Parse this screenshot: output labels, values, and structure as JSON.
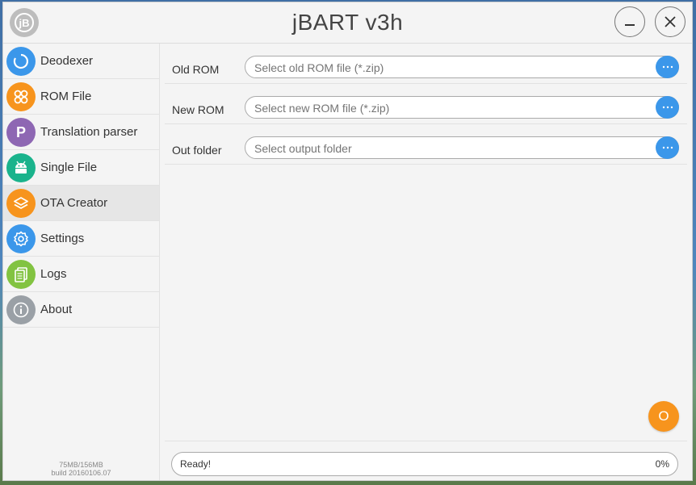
{
  "window": {
    "title": "jBART v3h",
    "logo_glyph": "jB"
  },
  "sidebar": {
    "items": [
      {
        "label": "Deodexer",
        "icon": "refresh-ring-icon",
        "color": "#3b97ea"
      },
      {
        "label": "ROM File",
        "icon": "grid-circles-icon",
        "color": "#f7941d"
      },
      {
        "label": "Translation parser",
        "icon": "p-letter-icon",
        "color": "#8e67b3"
      },
      {
        "label": "Single File",
        "icon": "android-icon",
        "color": "#1ab38c"
      },
      {
        "label": "OTA Creator",
        "icon": "layers-icon",
        "color": "#f7941d",
        "active": true
      },
      {
        "label": "Settings",
        "icon": "gear-icon",
        "color": "#3b97ea"
      },
      {
        "label": "Logs",
        "icon": "documents-icon",
        "color": "#82c341"
      },
      {
        "label": "About",
        "icon": "info-icon",
        "color": "#9aa0a6"
      }
    ],
    "memory": "75MB/156MB",
    "build": "build 20160106.07"
  },
  "form": {
    "rows": [
      {
        "label": "Old ROM",
        "placeholder": "Select old ROM file (*.zip)"
      },
      {
        "label": "New ROM",
        "placeholder": "Select new ROM file (*.zip)"
      },
      {
        "label": "Out folder",
        "placeholder": "Select output folder"
      }
    ],
    "browse_glyph": "···"
  },
  "action": {
    "start_label": "O",
    "color": "#f7941d"
  },
  "status": {
    "text": "Ready!",
    "percent": "0%"
  }
}
